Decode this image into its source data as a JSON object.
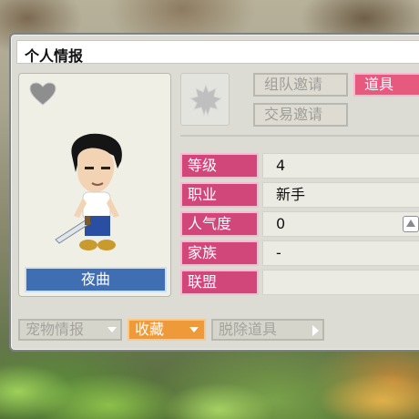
{
  "window": {
    "title": "个人情报"
  },
  "character": {
    "name": "夜曲"
  },
  "tabs": {
    "party_invite": "组队邀请",
    "trade_invite": "交易邀请",
    "items": "道具"
  },
  "info": {
    "level_label": "等级",
    "level_value": "4",
    "job_label": "职业",
    "job_value": "新手",
    "fame_label": "人气度",
    "fame_value": "0",
    "family_label": "家族",
    "family_value": "-",
    "alliance_label": "联盟",
    "alliance_value": ""
  },
  "bottom": {
    "pet_info": "宠物情报",
    "collect": "收藏",
    "unequip": "脱除道具"
  },
  "colors": {
    "label_pink": "#d1477a",
    "items_tab_pink": "#e65a80",
    "name_blue": "#3f6fb2",
    "collect_orange": "#ef9a3a"
  },
  "icons": {
    "heart": "heart-icon",
    "emblem": "maple-leaf-icon",
    "fame_up": "fame-up-icon",
    "fame_down": "fame-down-icon"
  }
}
